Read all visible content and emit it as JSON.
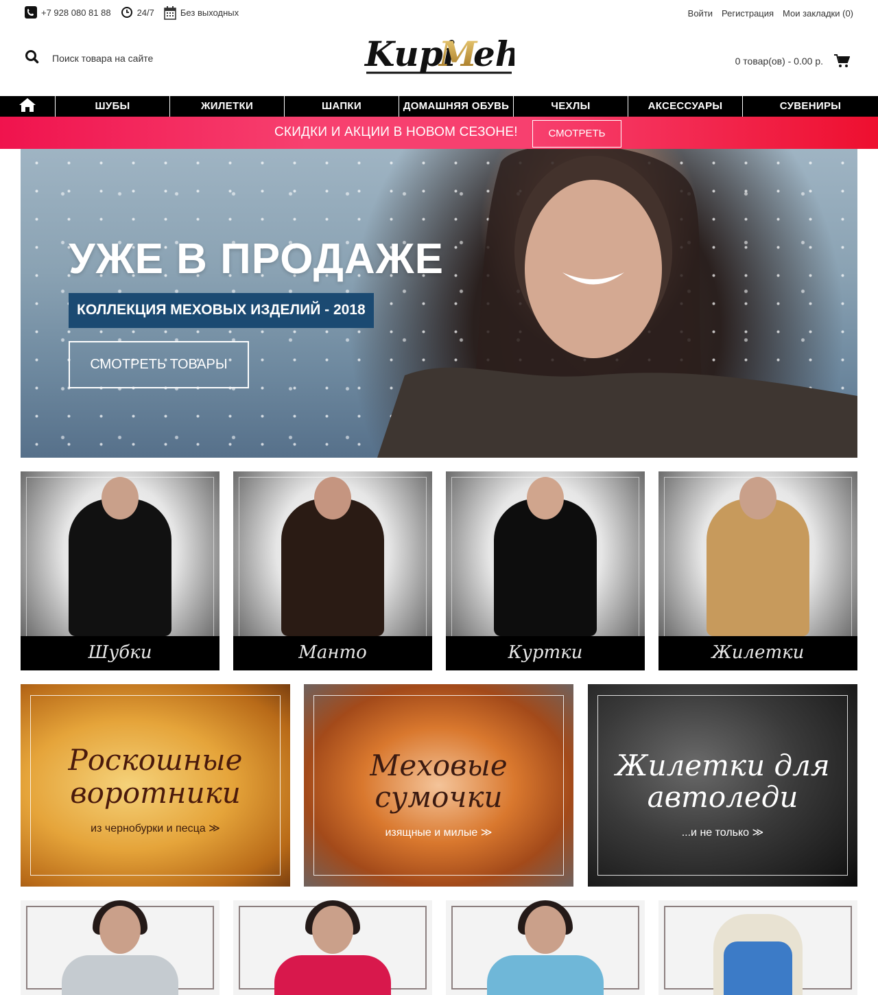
{
  "topbar": {
    "phone": "+7 928 080 81 88",
    "hours": "24/7",
    "days": "Без выходных",
    "login": "Войти",
    "register": "Регистрация",
    "bookmarks": "Мои закладки (0)"
  },
  "header": {
    "search_placeholder": "Поиск товара на сайте",
    "logo_text": "KupiMeh",
    "cart_text": "0 товар(ов) - 0.00 р."
  },
  "nav": {
    "items": [
      "ШУБЫ",
      "ЖИЛЕТКИ",
      "ШАПКИ",
      "ДОМАШНЯЯ ОБУВЬ",
      "ЧЕХЛЫ",
      "АКСЕССУАРЫ",
      "СУВЕНИРЫ"
    ]
  },
  "promo": {
    "text": "СКИДКИ И АКЦИИ В НОВОМ СЕЗОНЕ!",
    "button": "СМОТРЕТЬ"
  },
  "hero": {
    "title": "УЖЕ В ПРОДАЖЕ",
    "subtitle": "КОЛЛЕКЦИЯ МЕХОВЫХ ИЗДЕЛИЙ - 2018",
    "cta": "СМОТРЕТЬ ТОВАРЫ"
  },
  "categories": [
    {
      "label": "Шубки"
    },
    {
      "label": "Манто"
    },
    {
      "label": "Куртки"
    },
    {
      "label": "Жилетки"
    }
  ],
  "features": [
    {
      "title_line1": "Роскошные",
      "title_line2": "воротники",
      "caption": "из чернобурки и песца ≫"
    },
    {
      "title_line1": "Меховые",
      "title_line2": "сумочки",
      "caption": "изящные и милые ≫"
    },
    {
      "title_line1": "Жилетки для",
      "title_line2": "автоледи",
      "caption": "...и не только ≫"
    }
  ],
  "colors": {
    "nav_bg": "#000000",
    "promo_pink": "#f7406f",
    "hero_badge": "#1b4a72"
  }
}
